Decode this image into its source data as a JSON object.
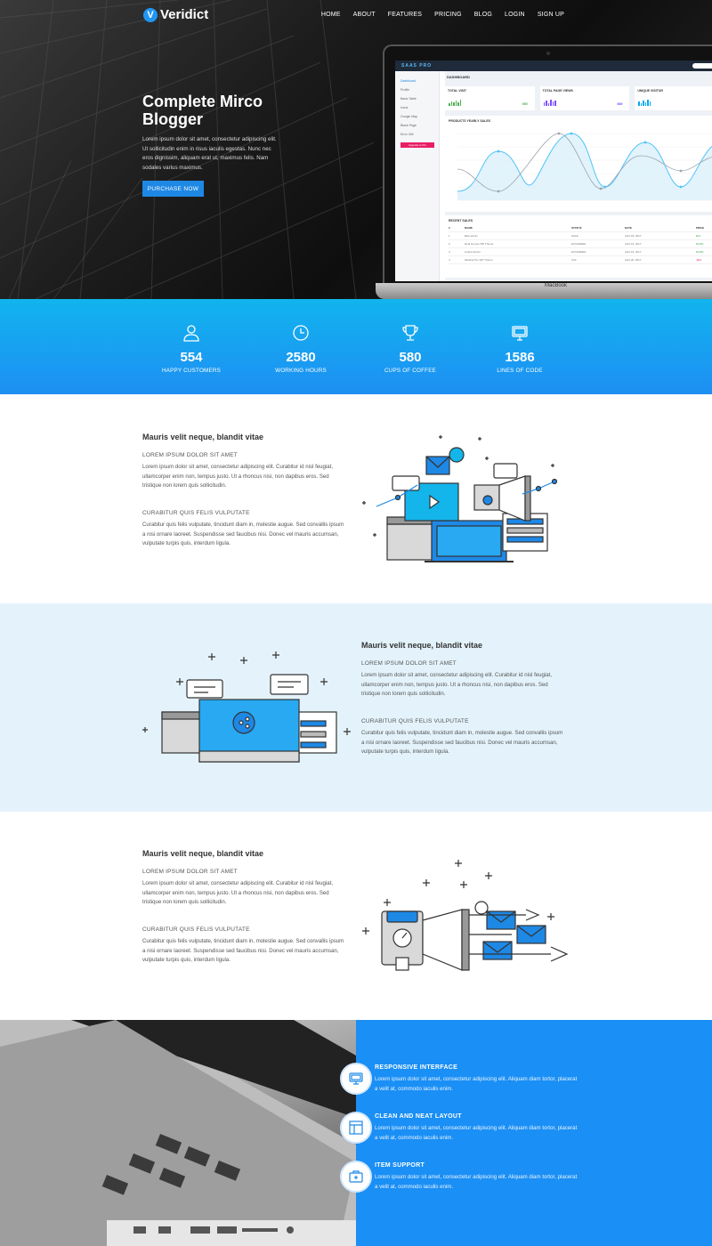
{
  "nav": {
    "brand": "Veridict",
    "brand_initial": "V",
    "links": [
      "HOME",
      "ABOUT",
      "FEATURES",
      "PRICING",
      "BLOG",
      "LOGIN",
      "SIGN UP"
    ]
  },
  "hero": {
    "title": "Complete Mirco Blogger",
    "text": "Lorem ipsum dolor sit amet, consectetur adipiscing elit. Ut sollicitudin enim in risus iaculis egestas. Nunc nec eros dignissim, aliquam erat ut, maximus felis. Nam sodales varius maximus.",
    "button": "PURCHASE NOW",
    "laptop_brand": "MacBook"
  },
  "dashboard": {
    "logo": "SAAS PRO",
    "heading": "DASHBOARD",
    "sidebar": [
      "Dashboard",
      "Profile",
      "Basic Table",
      "Icons",
      "Google Map",
      "Blank Page",
      "Error 404"
    ],
    "sidebar_button": "Upgrade to Pro",
    "stats": [
      {
        "label": "TOTAL VISIT",
        "value": "659",
        "color": "#4caf50"
      },
      {
        "label": "TOTAL PAGE VIEWS",
        "value": "869",
        "color": "#7c4dff"
      },
      {
        "label": "UNIQUE VISITOR",
        "value": "911",
        "color": "#03a9f4"
      }
    ],
    "chart_title": "PRODUCTS YEARLY SALES",
    "sales_title": "RECENT SALES",
    "sales_headers": [
      "#",
      "NAME",
      "STATUS",
      "DATE",
      "PRICE"
    ],
    "sales_rows": [
      [
        "1",
        "Elite admin",
        "SALE",
        "April 18, 2017",
        "$24"
      ],
      [
        "2",
        "Real Homes WP Theme",
        "EXTENDED",
        "April 19, 2017",
        "$1250"
      ],
      [
        "3",
        "Ample Admin",
        "EXTENDED",
        "April 19, 2017",
        "$1250"
      ],
      [
        "4",
        "Medical Pro WP Theme",
        "TAX",
        "April 20, 2017",
        "-$24"
      ]
    ]
  },
  "stats": [
    {
      "icon": "user-icon",
      "value": "554",
      "label": "HAPPY CUSTOMERS"
    },
    {
      "icon": "clock-icon",
      "value": "2580",
      "label": "WORKING HOURS"
    },
    {
      "icon": "trophy-icon",
      "value": "580",
      "label": "CUPS OF COFFEE"
    },
    {
      "icon": "monitor-icon",
      "value": "1586",
      "label": "LINES OF CODE"
    }
  ],
  "features": [
    {
      "title": "Mauris velit neque, blandit vitae",
      "sub1": "LOREM IPSUM DOLOR SIT AMET",
      "text1": "Lorem ipsum dolor sit amet, consectetur adipiscing elit. Curabitur id nisl feugiat, ullamcorper enim non, tempus justo. Ut a rhoncus nisi, non dapibus eros. Sed tristique non lorem quis sollicitudin.",
      "sub2": "CURABITUR QUIS FELIS VULPUTATE",
      "text2": "Curabitur quis felis vulputate, tincidunt diam in, molestie augue. Sed convallis ipsum a nisi ornare laoreet. Suspendisse sed faucibus nisi. Donec vel mauris accumsan, vulputate turpis quis, interdum ligula."
    },
    {
      "title": "Mauris velit neque, blandit vitae",
      "sub1": "LOREM IPSUM DOLOR SIT AMET",
      "text1": "Lorem ipsum dolor sit amet, consectetur adipiscing elit. Curabitur id nisl feugiat, ullamcorper enim non, tempus justo. Ut a rhoncus nisi, non dapibus eros. Sed tristique non lorem quis sollicitudin.",
      "sub2": "CURABITUR QUIS FELIS VULPUTATE",
      "text2": "Curabitur quis felis vulputate, tincidunt diam in, molestie augue. Sed convallis ipsum a nisi ornare laoreet. Suspendisse sed faucibus nisi. Donec vel mauris accumsan, vulputate turpis quis, interdum ligula."
    },
    {
      "title": "Mauris velit neque, blandit vitae",
      "sub1": "LOREM IPSUM DOLOR SIT AMET",
      "text1": "Lorem ipsum dolor sit amet, consectetur adipiscing elit. Curabitur id nisl feugiat, ullamcorper enim non, tempus justo. Ut a rhoncus nisi, non dapibus eros. Sed tristique non lorem quis sollicitudin.",
      "sub2": "CURABITUR QUIS FELIS VULPUTATE",
      "text2": "Curabitur quis felis vulputate, tincidunt diam in, molestie augue. Sed convallis ipsum a nisi ornare laoreet. Suspendisse sed faucibus nisi. Donec vel mauris accumsan, vulputate turpis quis, interdum ligula."
    }
  ],
  "bottom": {
    "items": [
      {
        "icon": "monitor-icon",
        "title": "RESPONSIVE INTERFACE",
        "text": "Lorem ipsum dolor sit amet, consectetur adipiscing elit. Aliquam diam tortor, placerat a velit at, commodo iaculis enim."
      },
      {
        "icon": "layout-icon",
        "title": "CLEAN AND NEAT LAYOUT",
        "text": "Lorem ipsum dolor sit amet, consectetur adipiscing elit. Aliquam diam tortor, placerat a velit at, commodo iaculis enim."
      },
      {
        "icon": "briefcase-icon",
        "title": "ITEM SUPPORT",
        "text": "Lorem ipsum dolor sit amet, consectetur adipiscing elit. Aliquam diam tortor, placerat a velit at, commodo iaculis enim."
      }
    ]
  },
  "colors": {
    "accent": "#1e88e5",
    "stats_top": "#11b4ee",
    "stats_bottom": "#1e8ff3",
    "feature_alt_bg": "#e4f3fb",
    "bottom_blue": "#1a8ff5"
  }
}
